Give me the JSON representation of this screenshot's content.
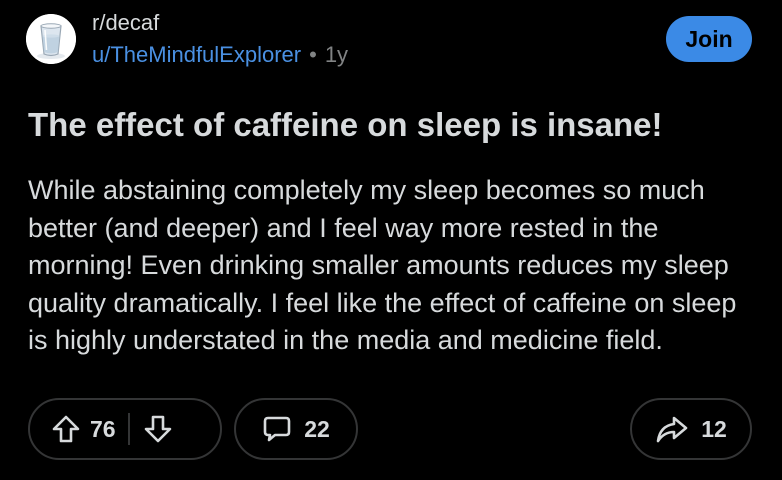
{
  "post": {
    "subreddit": "r/decaf",
    "author": "u/TheMindfulExplorer",
    "separator": "•",
    "age": "1y",
    "join_label": "Join",
    "title": "The effect of caffeine on sleep is insane!",
    "body": "While abstaining completely my sleep becomes so much better (and deeper) and I feel way more rested in the morning! Even drinking smaller amounts reduces my sleep quality dramatically. I feel like the effect of caffeine on sleep is highly understated in the media and medicine field."
  },
  "actions": {
    "upvotes": "76",
    "comments": "22",
    "shares": "12"
  },
  "icons": {
    "avatar": "glass-of-water-icon",
    "upvote": "arrow-up-icon",
    "downvote": "arrow-down-icon",
    "comment": "speech-bubble-icon",
    "share": "share-arrow-icon"
  },
  "colors": {
    "background": "#000000",
    "text": "#d7dadc",
    "author_link": "#4a90e2",
    "join_button": "#3b8ae6",
    "pill_border": "#343536",
    "muted": "#818384"
  }
}
